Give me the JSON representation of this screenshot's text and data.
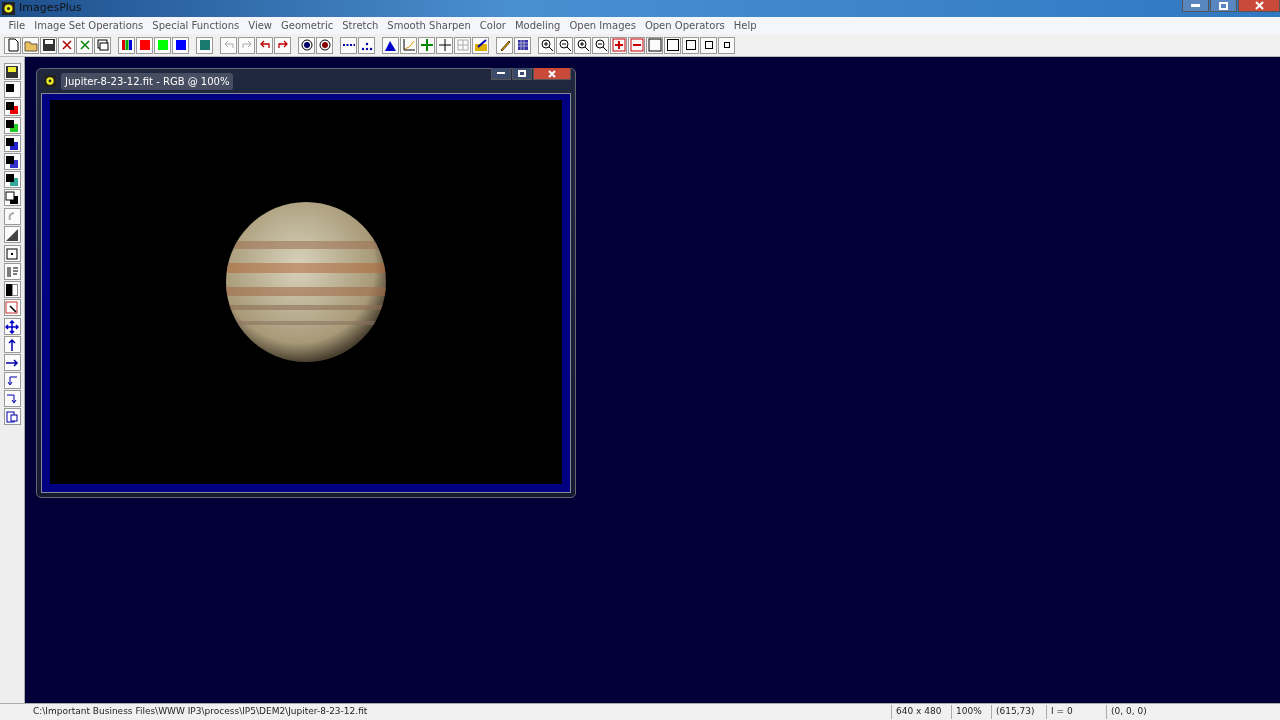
{
  "window": {
    "title": "ImagesPlus"
  },
  "menu": [
    "File",
    "Image Set Operations",
    "Special Functions",
    "View",
    "Geometric",
    "Stretch",
    "Smooth Sharpen",
    "Color",
    "Modeling",
    "Open Images",
    "Open Operators",
    "Help"
  ],
  "image_window": {
    "title": "Jupiter-8-23-12.fit - RGB @ 100%"
  },
  "status_bar": {
    "path": "C:\\Important Business Files\\WWW IP3\\process\\IP5\\DEM2\\Jupiter-8-23-12.fit",
    "fields": [
      "640 x 480",
      "100%",
      "(615,73)",
      "I = 0",
      "(0, 0, 0)"
    ]
  }
}
